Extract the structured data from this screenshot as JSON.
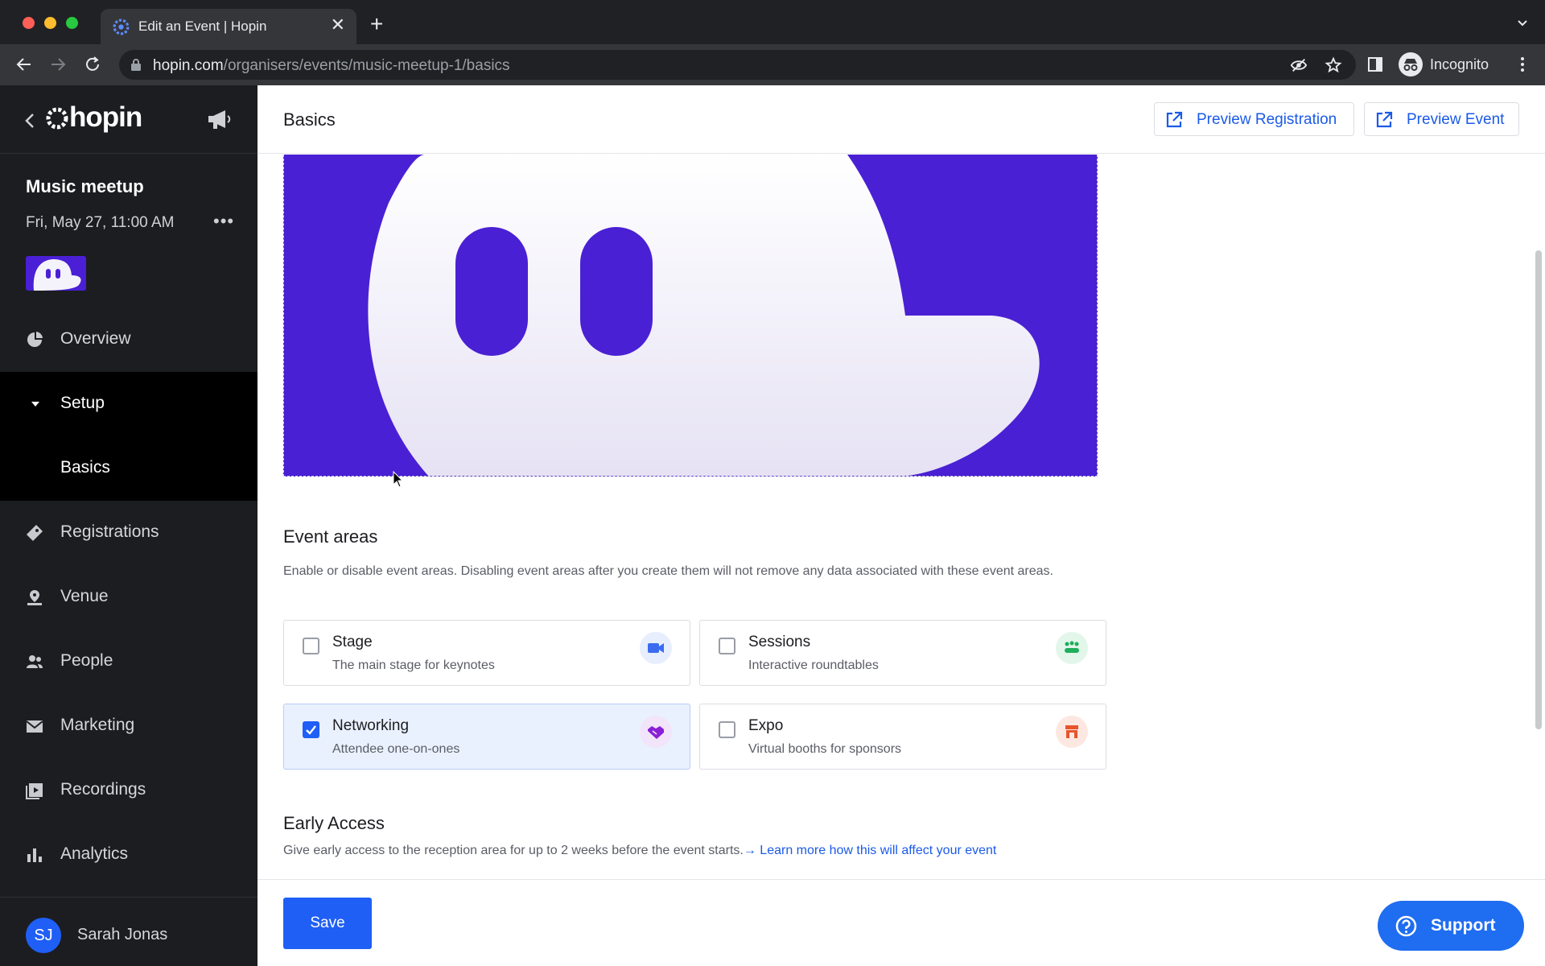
{
  "browser": {
    "tab_title": "Edit an Event | Hopin",
    "url_host": "hopin.com",
    "url_path": "/organisers/events/music-meetup-1/basics",
    "incognito_label": "Incognito",
    "new_tab_glyph": "+",
    "close_glyph": "✕"
  },
  "sidebar": {
    "brand": "hopin",
    "event_name": "Music meetup",
    "event_date": "Fri, May 27, 11:00 AM",
    "more_glyph": "•••",
    "nav": [
      {
        "label": "Overview",
        "icon": "pie-chart-icon"
      },
      {
        "label": "Setup",
        "icon": "caret-down-icon"
      },
      {
        "label": "Basics",
        "icon": ""
      },
      {
        "label": "Registrations",
        "icon": "ticket-icon"
      },
      {
        "label": "Venue",
        "icon": "map-pin-icon"
      },
      {
        "label": "People",
        "icon": "people-icon"
      },
      {
        "label": "Marketing",
        "icon": "envelope-icon"
      },
      {
        "label": "Recordings",
        "icon": "play-icon"
      },
      {
        "label": "Analytics",
        "icon": "bar-chart-icon"
      }
    ],
    "user": {
      "initials": "SJ",
      "name": "Sarah Jonas"
    }
  },
  "main": {
    "title": "Basics",
    "preview_registration": "Preview Registration",
    "preview_event": "Preview Event",
    "event_areas": {
      "title": "Event areas",
      "description": "Enable or disable event areas. Disabling event areas after you create them will not remove any data associated with these event areas.",
      "items": [
        {
          "name": "Stage",
          "sub": "The main stage for keynotes",
          "checked": false,
          "icon": "video-camera-icon",
          "color": "#3b6cf0"
        },
        {
          "name": "Sessions",
          "sub": "Interactive roundtables",
          "checked": false,
          "icon": "group-icon",
          "color": "#1fae5b"
        },
        {
          "name": "Networking",
          "sub": "Attendee one-on-ones",
          "checked": true,
          "icon": "handshake-icon",
          "color": "#8a1fd6"
        },
        {
          "name": "Expo",
          "sub": "Virtual booths for sponsors",
          "checked": false,
          "icon": "booth-icon",
          "color": "#e8542c"
        }
      ]
    },
    "early_access": {
      "title": "Early Access",
      "description": "Give early access to the reception area for up to 2 weeks before the event starts.",
      "link": "→ Learn more how this will affect your event"
    },
    "save_label": "Save",
    "support_label": "Support"
  },
  "colors": {
    "accent": "#1f5ff6",
    "banner": "#4a20d4",
    "sidebar": "#1c1d21"
  }
}
